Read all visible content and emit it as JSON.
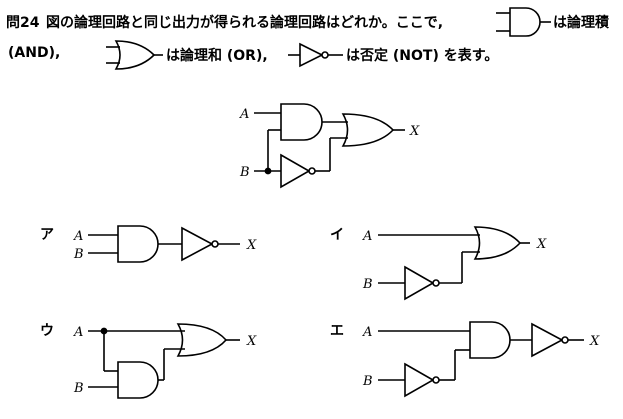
{
  "question": {
    "number": "問24",
    "text1": "図の論理回路と同じ出力が得られる論理回路はどれか。ここで,",
    "and_desc": "は論理積",
    "and_abbr": "(AND),",
    "or_desc": "は論理和 (OR),",
    "not_desc": "は否定 (NOT) を表す。"
  },
  "main_circuit": {
    "input_a": "A",
    "input_b": "B",
    "output": "X"
  },
  "options": [
    {
      "label": "ア",
      "input_a": "A",
      "input_b": "B",
      "output": "X"
    },
    {
      "label": "イ",
      "input_a": "A",
      "input_b": "B",
      "output": "X"
    },
    {
      "label": "ウ",
      "input_a": "A",
      "input_b": "B",
      "output": "X"
    },
    {
      "label": "エ",
      "input_a": "A",
      "input_b": "B",
      "output": "X"
    }
  ],
  "colors": {
    "ink": "#000000",
    "paper": "#ffffff"
  }
}
